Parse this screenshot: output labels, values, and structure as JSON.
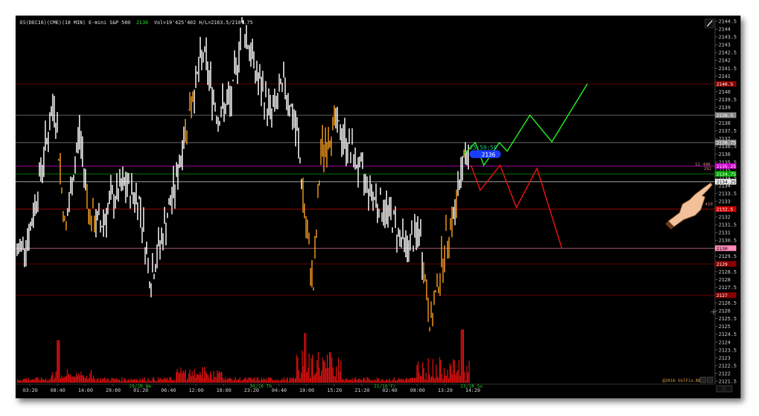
{
  "header": {
    "symbol": "ES(DEC16)(CME)(10 MIN) E-mini S&P 500",
    "last_price": "2136",
    "stats": "Vol=19'425'402 H/L=2163.5/2107.75"
  },
  "price_axis": {
    "labels": [
      "2144.5",
      "2144",
      "2143.5",
      "2143",
      "2142.5",
      "2142",
      "2141.5",
      "2141",
      "2140.5",
      "2140",
      "2139.5",
      "2139",
      "2138.5",
      "2138",
      "2137.5",
      "2137",
      "2136.5",
      "2136",
      "2135.5",
      "2135",
      "2134.5",
      "2134",
      "2133.5",
      "2133",
      "2132.5",
      "2132",
      "2131.5",
      "2131",
      "2130.5",
      "2130",
      "2129.5",
      "2129",
      "2128.5",
      "2128",
      "2127.5",
      "2127",
      "2126.5",
      "2126",
      "2125.5",
      "2125",
      "2124.5",
      "2124",
      "2123.5",
      "2123",
      "2122.5",
      "2122",
      "2121.5"
    ]
  },
  "price_tags": [
    {
      "label": "2140.5",
      "price": 2140.5,
      "color": "#8b0000"
    },
    {
      "label": "2138.5",
      "price": 2138.5,
      "color": "#8a8a8a"
    },
    {
      "label": "2136.75",
      "price": 2136.75,
      "color": "#8a8a8a"
    },
    {
      "label": "2135.25",
      "price": 2135.25,
      "color": "#cc00cc"
    },
    {
      "label": "2134.75",
      "price": 2134.75,
      "color": "#00aa00"
    },
    {
      "label": "2134.25",
      "price": 2134.25,
      "color": "#eeeeee"
    },
    {
      "label": "2132.5",
      "price": 2132.5,
      "color": "#cc0000"
    },
    {
      "label": "2130",
      "price": 2130,
      "color": "#ff88bb"
    },
    {
      "label": "2129",
      "price": 2129,
      "color": "#8b0000"
    },
    {
      "label": "2127",
      "price": 2127,
      "color": "#8b0000"
    }
  ],
  "level_notes": [
    "S1 400",
    "292",
    "410"
  ],
  "time_labels": [
    "03:20",
    "08:40",
    "14:00",
    "20:00",
    "01:20",
    "06:40",
    "12:00",
    "18:00",
    "23:20",
    "04:40",
    "10:00",
    "15:20",
    "21:20",
    "02:40",
    "08:00",
    "13:20",
    "14:20"
  ],
  "date_labels": [
    "19/10 We",
    "20/10 Th",
    "21/10 Fr",
    "23/10 Su"
  ],
  "current_price_box": {
    "price": "2136",
    "countdown": "25:59:59"
  },
  "scenario": {
    "bull_color": "#22ee22",
    "bear_color": "#ee1111",
    "bull_target": 2140.5,
    "bear_target": 2130
  },
  "copyright": "@2016 VolFix.NET",
  "colors": {
    "bull_bar": "#ffffff",
    "bear_bar": "#f39a1c",
    "volume": "#ee1111",
    "background": "#000000"
  }
}
